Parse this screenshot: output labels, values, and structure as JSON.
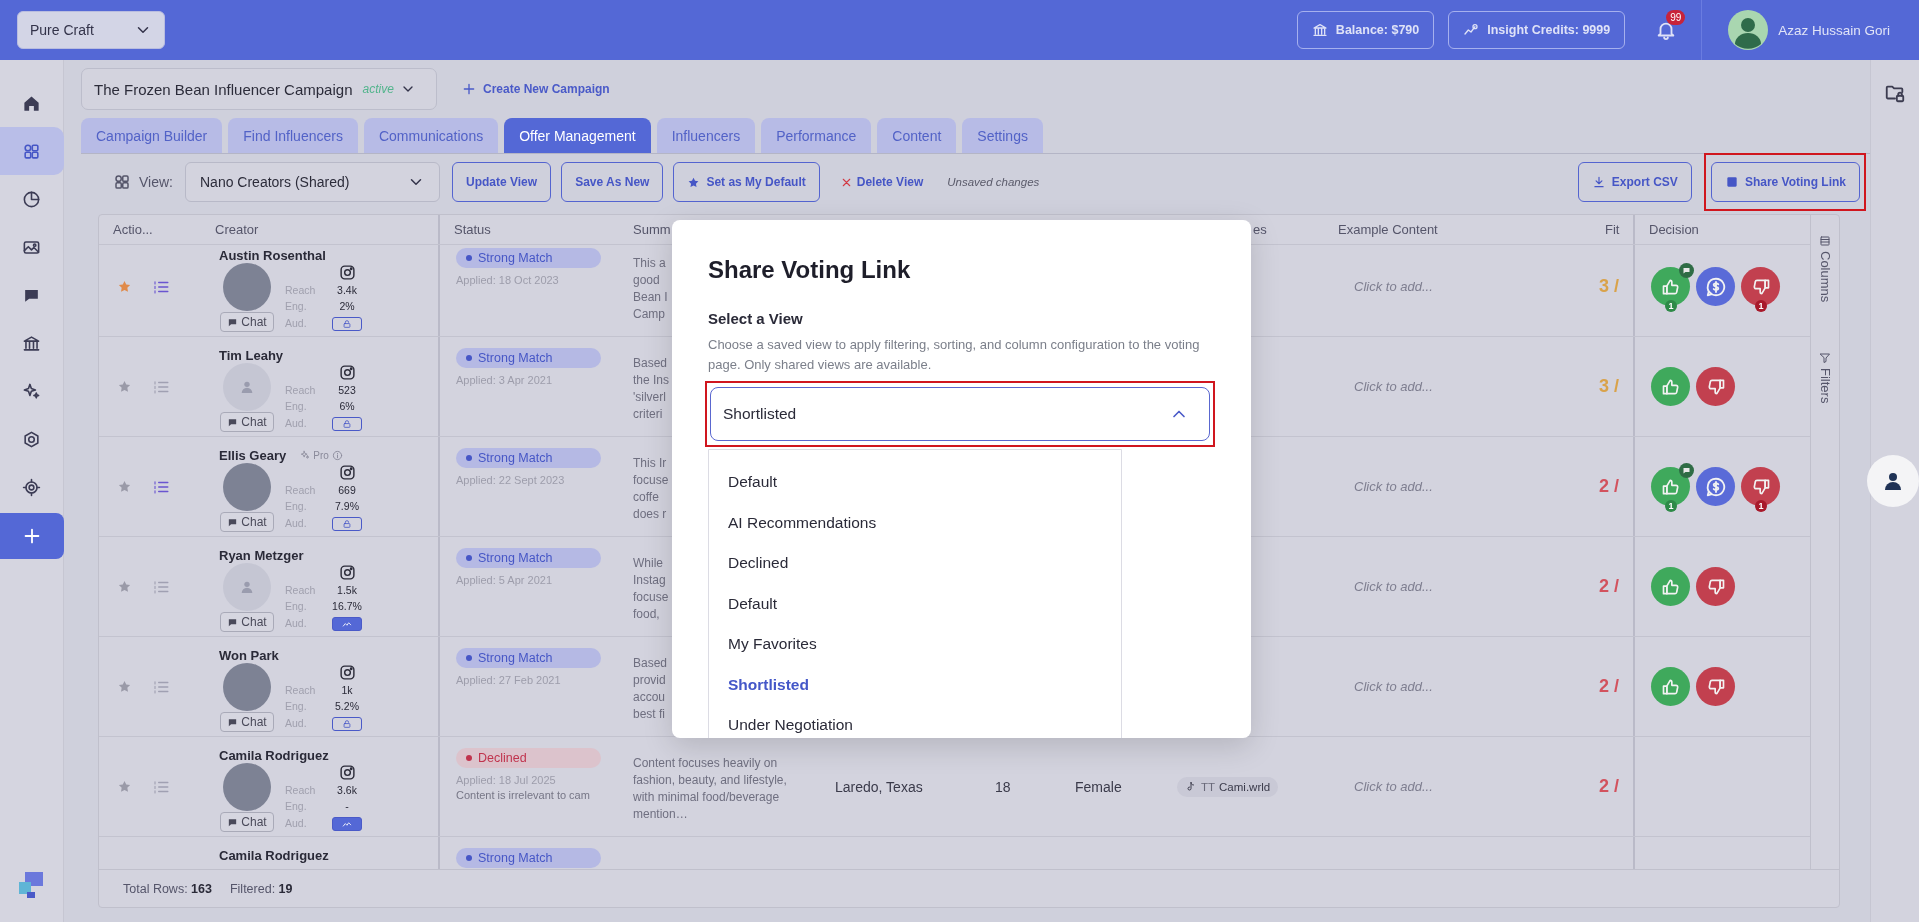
{
  "topbar": {
    "workspace": "Pure Craft",
    "balance": "Balance: $790",
    "credits": "Insight Credits: 9999",
    "notifications": "99",
    "user": "Azaz Hussain Gori"
  },
  "sidebar": {
    "items": [
      {
        "selected": false
      },
      {
        "selected": true
      },
      {
        "selected": false
      },
      {
        "selected": false
      },
      {
        "selected": false
      },
      {
        "selected": false
      },
      {
        "selected": false
      },
      {
        "selected": false
      },
      {
        "selected": false
      }
    ]
  },
  "campaign": {
    "name": "The Frozen Bean Influencer Campaign",
    "status": "active",
    "create": "Create New Campaign"
  },
  "tabs": [
    {
      "label": "Campaign Builder",
      "selected": false
    },
    {
      "label": "Find Influencers",
      "selected": false
    },
    {
      "label": "Communications",
      "selected": false
    },
    {
      "label": "Offer Management",
      "selected": true
    },
    {
      "label": "Influencers",
      "selected": false
    },
    {
      "label": "Performance",
      "selected": false
    },
    {
      "label": "Content",
      "selected": false
    },
    {
      "label": "Settings",
      "selected": false
    }
  ],
  "toolbar": {
    "view_label": "View:",
    "view": "Nano Creators (Shared)",
    "buttons": [
      {
        "label": "Update View",
        "kind": "plain"
      },
      {
        "label": "Save As New",
        "kind": "plain"
      },
      {
        "label": "Set as My Default",
        "kind": "star"
      }
    ],
    "delete": "Delete View",
    "unsaved": "Unsaved changes",
    "export": "Export CSV",
    "share": "Share Voting Link"
  },
  "table": {
    "columns": [
      {
        "label": "Actio..."
      },
      {
        "label": "Creator"
      },
      {
        "label": "Status"
      },
      {
        "label": "Summ"
      },
      {
        "label": "es"
      },
      {
        "label": "Example Content"
      },
      {
        "label": "Fit"
      },
      {
        "label": "Decision"
      }
    ],
    "rows": [
      {
        "favorite": true,
        "listed": true,
        "name": "Austin Rosenthal",
        "avatar": {
          "kind": "photo"
        },
        "chat": "Chat",
        "stats": [
          {
            "label": "Reach",
            "value": "3.4k"
          },
          {
            "label": "Eng.",
            "value": "2%"
          },
          {
            "label": "Aud.",
            "kind": "locked"
          }
        ],
        "status": {
          "label": "Strong Match",
          "kind": "match",
          "applied": "Applied: 18 Oct 2023"
        },
        "summary": [
          "This a",
          "good",
          "Bean I",
          "Camp"
        ],
        "example": "Click to add...",
        "fit": {
          "text": "3 /",
          "color": "#d9a24a"
        },
        "decision": {
          "approve": true,
          "approve_count": "1",
          "comment": true,
          "offer": true,
          "reject": true,
          "reject_count": "1"
        }
      },
      {
        "favorite": false,
        "listed": false,
        "name": "Tim Leahy",
        "avatar": {
          "kind": "placeholder"
        },
        "chat": "Chat",
        "stats": [
          {
            "label": "Reach",
            "value": "523"
          },
          {
            "label": "Eng.",
            "value": "6%"
          },
          {
            "label": "Aud.",
            "kind": "locked"
          }
        ],
        "status": {
          "label": "Strong Match",
          "kind": "match",
          "applied": "Applied: 3 Apr 2021"
        },
        "summary": [
          "Based",
          "the Ins",
          "'silverl",
          "criteri"
        ],
        "example": "Click to add...",
        "fit": {
          "text": "3 /",
          "color": "#d9a24a"
        },
        "decision": {
          "approve": true,
          "reject": true
        }
      },
      {
        "favorite": false,
        "listed": true,
        "name": "Ellis Geary",
        "pro": "Pro",
        "avatar": {
          "kind": "photo"
        },
        "chat": "Chat",
        "stats": [
          {
            "label": "Reach",
            "value": "669"
          },
          {
            "label": "Eng.",
            "value": "7.9%"
          },
          {
            "label": "Aud.",
            "kind": "locked"
          }
        ],
        "status": {
          "label": "Strong Match",
          "kind": "match",
          "applied": "Applied: 22 Sept 2023"
        },
        "summary": [
          "This Ir",
          "focuse",
          "coffe",
          "does r"
        ],
        "example": "Click to add...",
        "fit": {
          "text": "2 /",
          "color": "#d2525e"
        },
        "decision": {
          "approve": true,
          "approve_count": "1",
          "comment": true,
          "offer": true,
          "reject": true,
          "reject_count": "1"
        }
      },
      {
        "favorite": false,
        "listed": false,
        "name": "Ryan Metzger",
        "avatar": {
          "kind": "placeholder"
        },
        "chat": "Chat",
        "stats": [
          {
            "label": "Reach",
            "value": "1.5k"
          },
          {
            "label": "Eng.",
            "value": "16.7%"
          },
          {
            "label": "Aud.",
            "kind": "chart"
          }
        ],
        "status": {
          "label": "Strong Match",
          "kind": "match",
          "applied": "Applied: 5 Apr 2021"
        },
        "summary": [
          "While",
          "Instag",
          "focuse",
          "food,"
        ],
        "example": "Click to add...",
        "fit": {
          "text": "2 /",
          "color": "#d2525e"
        },
        "decision": {
          "approve": true,
          "reject": true
        }
      },
      {
        "favorite": false,
        "listed": false,
        "name": "Won Park",
        "avatar": {
          "kind": "photo"
        },
        "chat": "Chat",
        "stats": [
          {
            "label": "Reach",
            "value": "1k"
          },
          {
            "label": "Eng.",
            "value": "5.2%"
          },
          {
            "label": "Aud.",
            "kind": "locked"
          }
        ],
        "status": {
          "label": "Strong Match",
          "kind": "match",
          "applied": "Applied: 27 Feb 2021"
        },
        "summary": [
          "Based",
          "provid",
          "accou",
          "best fi"
        ],
        "example": "Click to add...",
        "fit": {
          "text": "2 /",
          "color": "#d2525e"
        },
        "decision": {
          "approve": true,
          "reject": true
        }
      },
      {
        "favorite": false,
        "listed": false,
        "name": "Camila Rodriguez",
        "avatar": {
          "kind": "photo"
        },
        "chat": "Chat",
        "stats": [
          {
            "label": "Reach",
            "value": "3.6k"
          },
          {
            "label": "Eng.",
            "value": "-"
          },
          {
            "label": "Aud.",
            "kind": "chart"
          }
        ],
        "status": {
          "label": "Declined",
          "kind": "declined",
          "applied": "Applied: 18 Jul 2025",
          "note": "Content is irrelevant to cam"
        },
        "summary": [
          "Content focuses heavily on fashion, beauty, and lifestyle, with minimal food/beverage mention…"
        ],
        "location": "Laredo, Texas",
        "age": "18",
        "gender": "Female",
        "social": {
          "network": "TT",
          "handle": "Cami.wrld"
        },
        "example": "Click to add...",
        "fit": {
          "text": "2 /",
          "color": "#d2525e"
        }
      },
      {
        "name": "Camila Rodriguez",
        "status": {
          "label": "Strong Match",
          "kind": "match"
        }
      }
    ],
    "side_tabs": [
      "Columns",
      "Filters"
    ],
    "footer": {
      "total": "Total Rows: **163**",
      "filtered": "Filtered: **19**"
    }
  },
  "share_modal": {
    "title": "Share Voting Link",
    "label": "Select a View",
    "description": "Choose a saved view to apply filtering, sorting, and column configuration to the voting page. Only shared views are available.",
    "select": {
      "value": "Shortlisted",
      "expanded": true
    },
    "options": [
      {
        "label": "Default",
        "selected": false
      },
      {
        "label": "AI Recommendations",
        "selected": false
      },
      {
        "label": "Declined",
        "selected": false
      },
      {
        "label": "Default",
        "selected": false
      },
      {
        "label": "My Favorites",
        "selected": false
      },
      {
        "label": "Shortlisted",
        "selected": true
      },
      {
        "label": "Under Negotiation",
        "selected": false
      }
    ]
  }
}
